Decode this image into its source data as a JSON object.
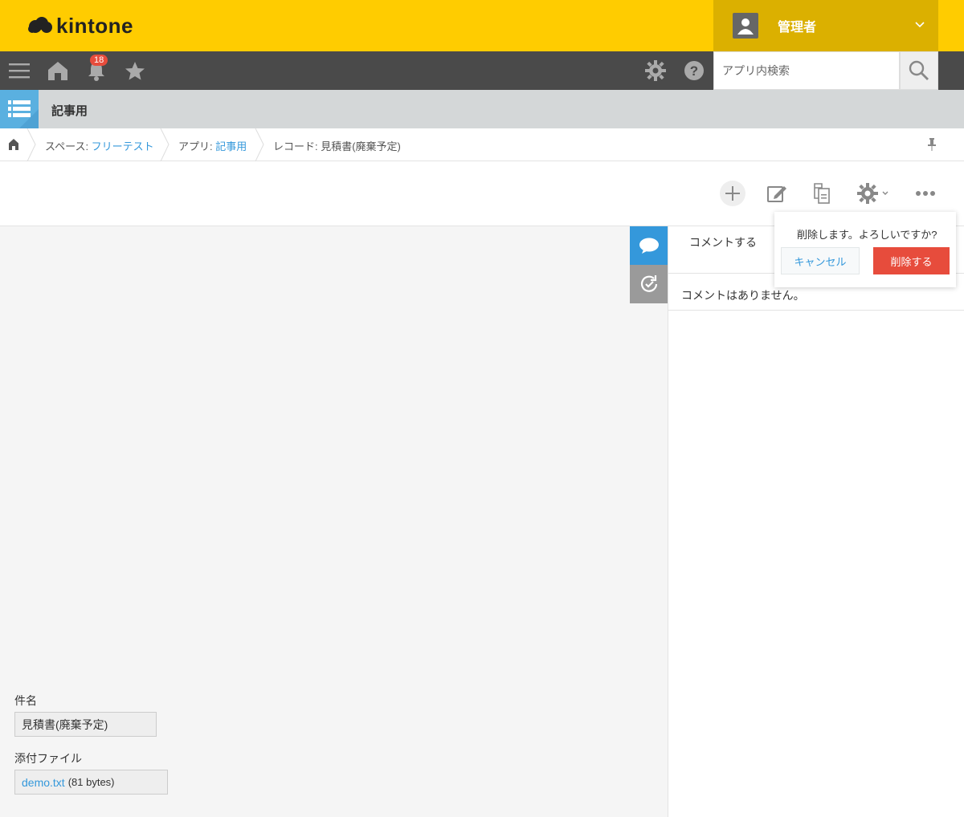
{
  "header": {
    "logo_text": "kintone",
    "user_name": "管理者"
  },
  "navbar": {
    "notification_count": "18",
    "search_placeholder": "アプリ内検索"
  },
  "app": {
    "title": "記事用"
  },
  "breadcrumb": {
    "space_label": "スペース: ",
    "space_link": "フリーテスト",
    "app_label": "アプリ: ",
    "app_link": "記事用",
    "record_label": "レコード: 見積書(廃棄予定)"
  },
  "delete_popover": {
    "message": "削除します。よろしいですか?",
    "cancel_label": "キャンセル",
    "delete_label": "削除する"
  },
  "comment_panel": {
    "tab_label": "コメントする",
    "empty_text": "コメントはありません。"
  },
  "fields": {
    "title_label": "件名",
    "title_value": "見積書(廃棄予定)",
    "attachment_label": "添付ファイル",
    "attachment_file": "demo.txt",
    "attachment_size": "(81 bytes)"
  },
  "colors": {
    "header_yellow": "#ffcc00",
    "user_area": "#dbb000",
    "navbar_gray": "#4a4a4a",
    "link_blue": "#3498db",
    "delete_red": "#e74c3c",
    "comment_tab_blue": "#3498db"
  }
}
